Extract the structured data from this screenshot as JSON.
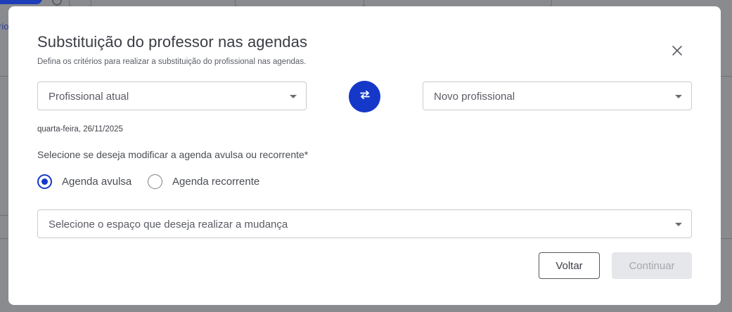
{
  "background": {
    "left_text": "rio"
  },
  "modal": {
    "title": "Substituição do professor nas agendas",
    "subtitle": "Defina os critérios para realizar a substituição do profissional nas agendas.",
    "current_professional_placeholder": "Profissional atual",
    "new_professional_placeholder": "Novo profissional",
    "date": "quarta-feira, 26/11/2025",
    "schedule_question": "Selecione se deseja modificar a agenda avulsa ou recorrente*",
    "radio_options": [
      {
        "label": "Agenda avulsa",
        "selected": true
      },
      {
        "label": "Agenda recorrente",
        "selected": false
      }
    ],
    "space_placeholder": "Selecione o espaço que deseja realizar a mudança",
    "back_label": "Voltar",
    "continue_label": "Continuar"
  },
  "colors": {
    "accent": "#1538c9",
    "disabled_bg": "#e6e7ea",
    "overlay": "#8a8b8f"
  },
  "icons": {
    "close": "close-icon",
    "swap": "swap-arrows-icon",
    "dropdown": "chevron-down-icon"
  }
}
